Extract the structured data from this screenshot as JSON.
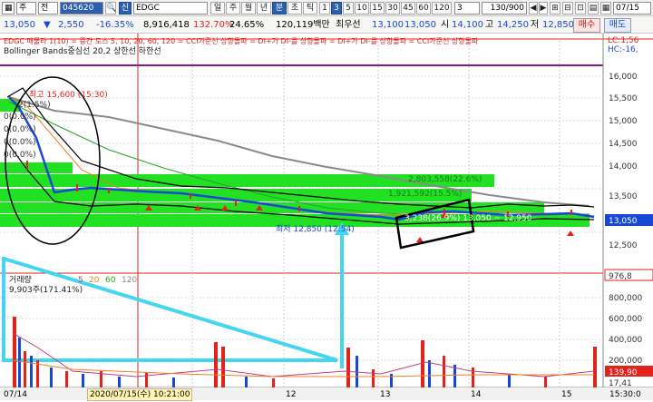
{
  "toolbar": {
    "code_value": "045620",
    "market_badge": "신",
    "stock_name": "EDGC",
    "periods": [
      "일",
      "주",
      "월",
      "년",
      "분",
      "초",
      "틱"
    ],
    "minutes": [
      "1",
      "3",
      "5",
      "10",
      "15",
      "30",
      "45",
      "60",
      "120"
    ],
    "count_value": "3",
    "range_value": "130/900",
    "date_value": "07/15",
    "left_combo": "주",
    "left_combo2": "전"
  },
  "quote": {
    "price": "13,050",
    "change": "2,550",
    "change_pct": "-16.35%",
    "volume": "8,916,418",
    "vol_ratio": "132.70%",
    "turnover": "24.65%",
    "amount": "120,119백만",
    "best_label": "최우선",
    "best_ask": "13,100",
    "best_bid": "13,050",
    "open_label": "시",
    "open": "14,100",
    "high_label": "고",
    "high": "14,250",
    "low_label": "저",
    "low": "12,850",
    "buy_label": "매수",
    "sell_label": "매도"
  },
  "legend": {
    "ma_line": "EDGC 매물라 1(10) = 중간 도스 5, 10, 20, 60, 120 = CCI가준선 상향돌파 = DI+가 DI-를 상향돌파 = DI+가 DI-를 상향돌파 = CCI가준선 상향돌파",
    "bb_line": "Bollinger Bands중심선 20,2  상한선  하한선",
    "lc_label": "LC:1,56",
    "hc_label": "HC:-16,"
  },
  "annotations": {
    "max_label": "최고 15,600 (15:30)",
    "min_label": "최저 12,850 (12:54)",
    "pct_labels": [
      "2(1.5%)",
      "0(0.0%)",
      "0(0.0%)",
      "0(0.0%)",
      "0(0.0%)"
    ],
    "vp_label_1": "2,803,558(22.6%)",
    "vp_label_2": "1,921,592(15.5%)",
    "vp_label_3": "1,9??,??2(15.5%)",
    "box_label": "3,238(26.9%) 13,050 ~ 12,950",
    "current_tag": "13,050"
  },
  "volume_panel": {
    "title": "거래량",
    "ma_labels": [
      "5",
      "20",
      "60",
      "120"
    ],
    "current_label": "9,903주(171.41%)",
    "axis_labels": [
      "800,000",
      "600,000",
      "400,000",
      "200,000"
    ],
    "tag_top": "976,8",
    "tag_mid": "139,90",
    "tag_bot": "17,41"
  },
  "price_axis": [
    "16,000",
    "15,500",
    "15,000",
    "14,500",
    "14,000",
    "13,500",
    "13,050",
    "12,500"
  ],
  "time_axis": {
    "start": "07/14",
    "cursor": "2020/07/15(수) 10:21:00",
    "labels": [
      "12",
      "13",
      "14",
      "15"
    ],
    "end": "15:30:0"
  },
  "colors": {
    "up": "#e2221b",
    "down": "#1848d8",
    "ma5": "#f08020",
    "ma_long": "#8a8a8a",
    "bollinger": "#000000",
    "volume_profile": "#22e022",
    "annotation_cyan": "#44d6f0"
  }
}
